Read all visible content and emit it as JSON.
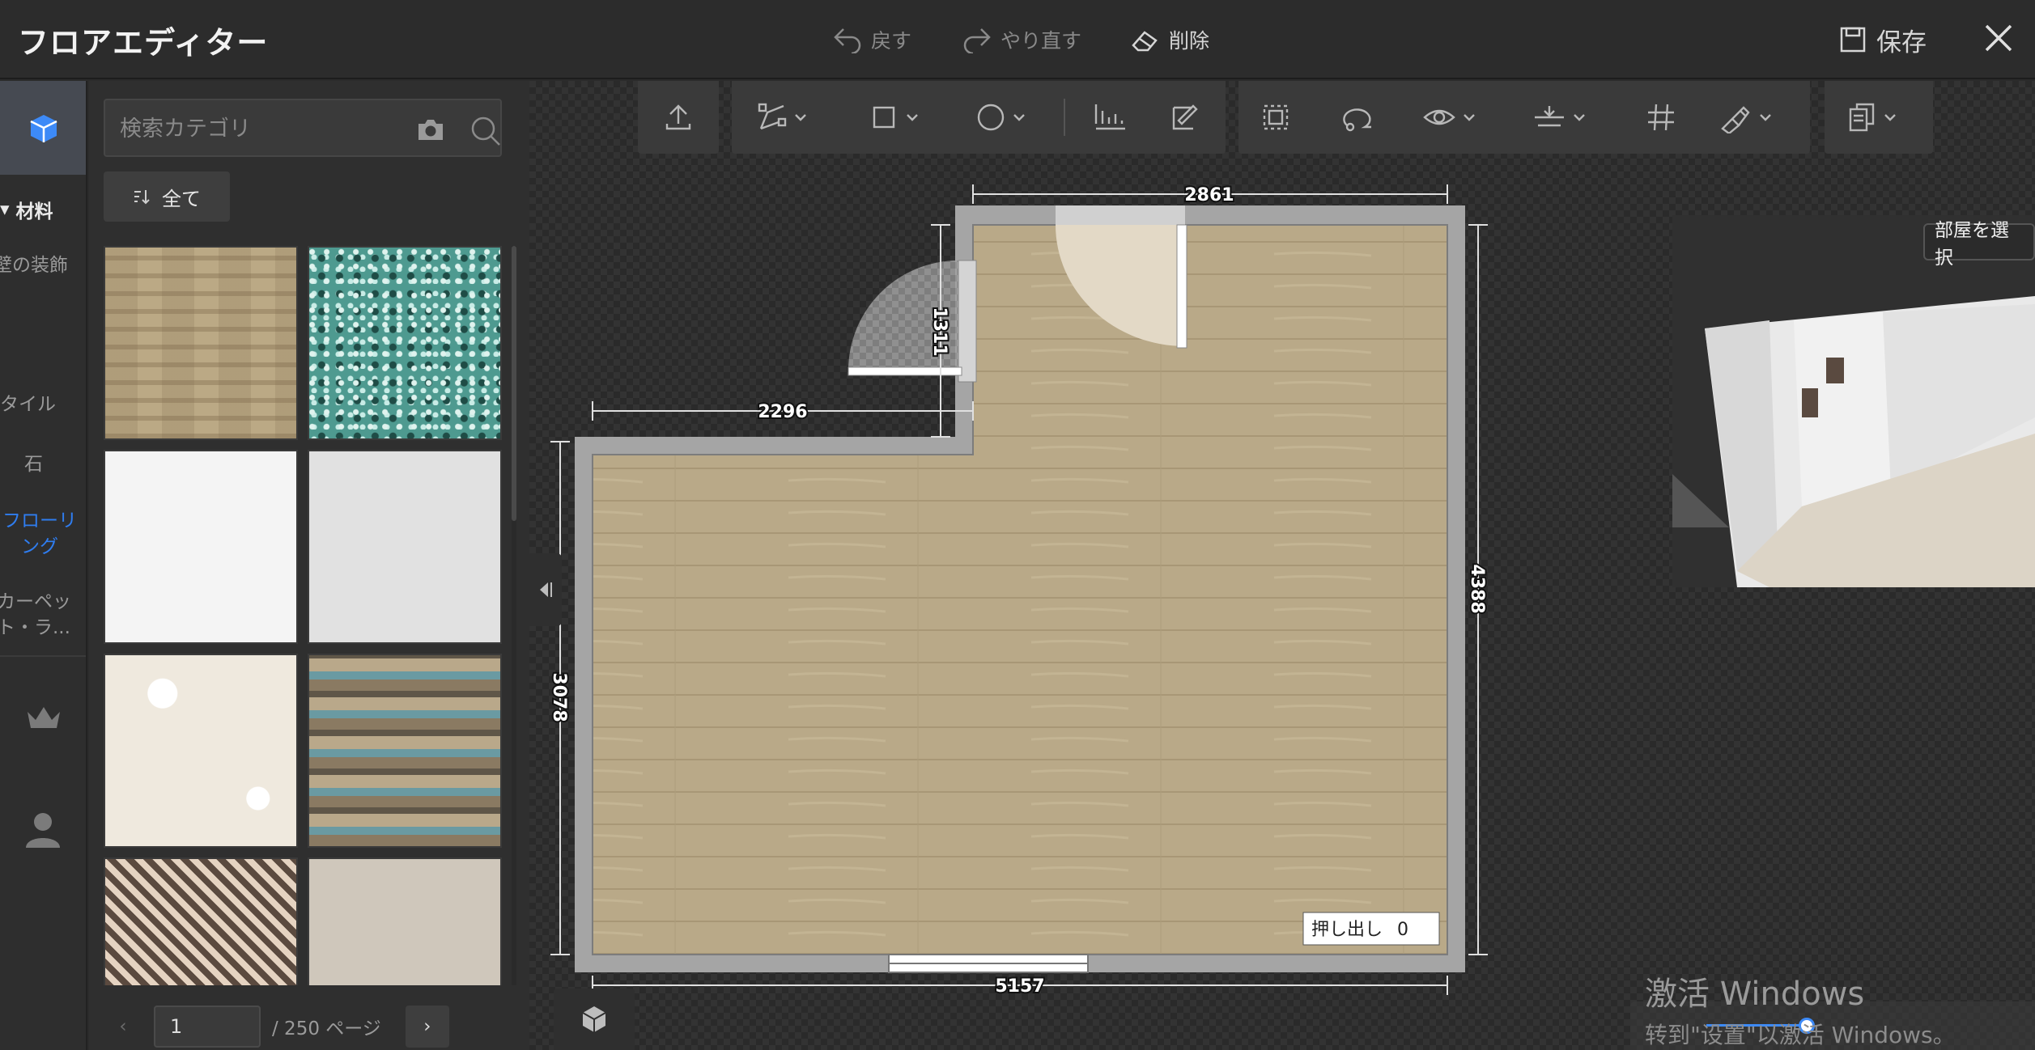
{
  "app": {
    "title": "フロアエディター",
    "undo": "戻す",
    "redo": "やり直す",
    "delete": "削除",
    "save": "保存"
  },
  "sidebar": {
    "section": "材料",
    "items": [
      {
        "label": "壁の装飾"
      },
      {
        "label": "タイル"
      },
      {
        "label": "石"
      },
      {
        "label": "フローリング"
      },
      {
        "label": "カーペット・ラ..."
      }
    ]
  },
  "panel": {
    "search_placeholder": "検索カテゴリ",
    "filter_label": "全て",
    "page_value": "1",
    "page_suffix": "/ 250 ページ"
  },
  "plan": {
    "dims": {
      "top": "2861",
      "notch_height": "1311",
      "notch_width": "2296",
      "left": "3078",
      "right": "4388",
      "bottom": "5157"
    },
    "extrude_label": "押し出し",
    "extrude_value": "0"
  },
  "preview": {
    "select_room": "部屋を選択"
  },
  "os_watermark": {
    "title": "激活 Windows",
    "subtitle": "转到\"设置\"以激活 Windows。"
  },
  "colors": {
    "accent": "#2f7df0",
    "floor": "#b9a988",
    "wall": "#a7a7a7",
    "background": "#2b2b2b"
  }
}
